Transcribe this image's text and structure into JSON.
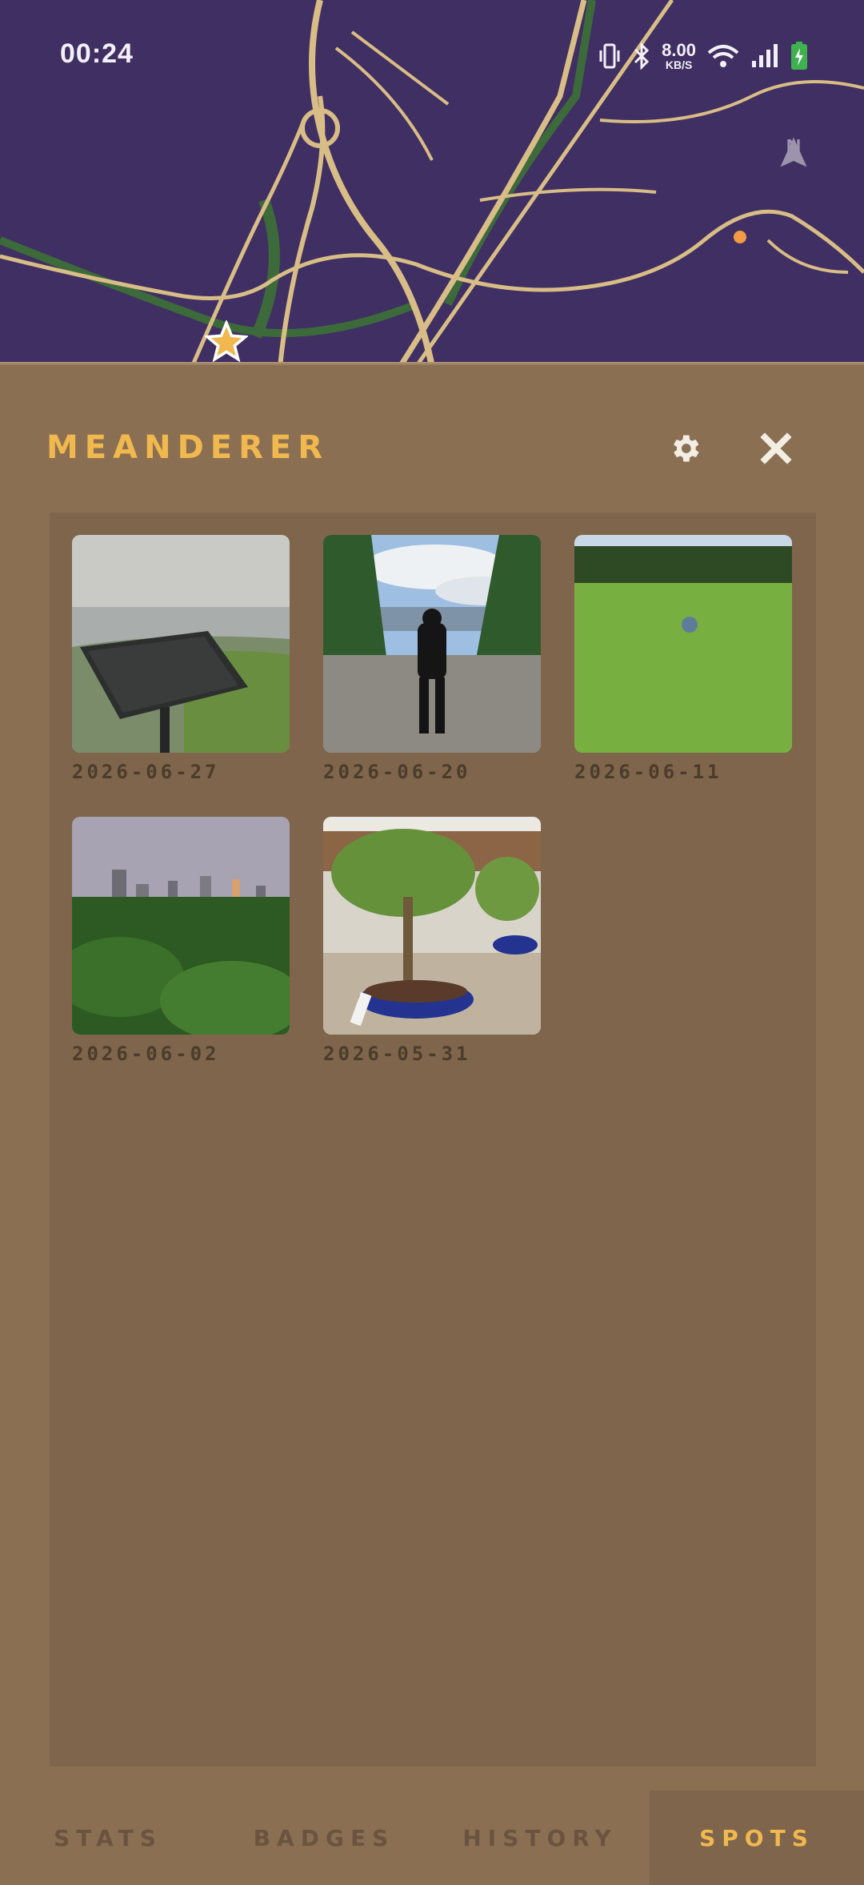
{
  "status_bar": {
    "time": "00:24",
    "net_speed_value": "8.00",
    "net_speed_unit": "KB/S",
    "icons": [
      "vibrate-icon",
      "bluetooth-icon",
      "wifi-icon",
      "signal-icon",
      "battery-charging-icon"
    ]
  },
  "map": {
    "compass_label": "N",
    "colors": {
      "land": "#3f2f63",
      "roads": "#d9bd86",
      "green": "#3d6a3a",
      "marker": "#f0b84e",
      "dot": "#f39a45"
    }
  },
  "header": {
    "title": "MEANDERER",
    "settings_icon": "gear-icon",
    "close_icon": "close-icon"
  },
  "spots": [
    {
      "date": "2026-06-27",
      "scene": "harbor-plaque"
    },
    {
      "date": "2026-06-20",
      "scene": "person-overlook"
    },
    {
      "date": "2026-06-11",
      "scene": "grass-field"
    },
    {
      "date": "2026-06-02",
      "scene": "city-skyline"
    },
    {
      "date": "2026-05-31",
      "scene": "bonsai"
    }
  ],
  "tabs": [
    {
      "label": "STATS",
      "active": false
    },
    {
      "label": "BADGES",
      "active": false
    },
    {
      "label": "HISTORY",
      "active": false
    },
    {
      "label": "SPOTS",
      "active": true
    }
  ],
  "colors": {
    "accent": "#f0b84e",
    "sheet": "#8a6f52",
    "panel": "#7e654b"
  }
}
